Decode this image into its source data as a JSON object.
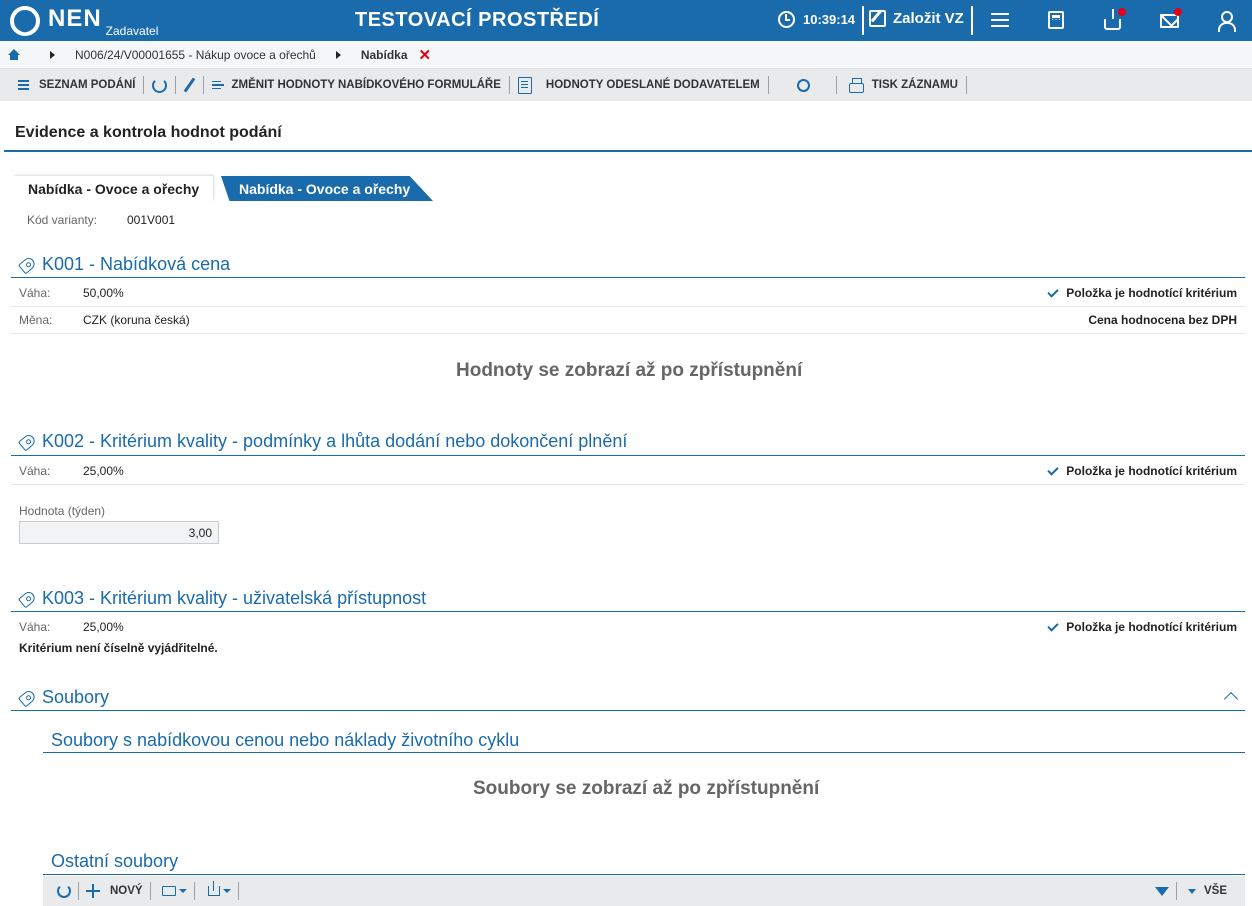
{
  "header": {
    "logo_text": "NEN",
    "logo_sub": "Zadavatel",
    "env_title": "TESTOVACÍ PROSTŘEDÍ",
    "time": "10:39:14",
    "create_label": "Založit VZ"
  },
  "breadcrumb": {
    "item1": "N006/24/V00001655 - Nákup ovoce a ořechů",
    "item2": "Nabídka",
    "close_glyph": "✕"
  },
  "toolbar": {
    "list_label": "SEZNAM PODÁNÍ",
    "change_values_label": "ZMĚNIT HODNOTY NABÍDKOVÉHO FORMULÁŘE",
    "sent_values_label": "HODNOTY ODESLANÉ DODAVATELEM",
    "print_label": "TISK ZÁZNAMU"
  },
  "page": {
    "title": "Evidence a kontrola hodnot podání",
    "tabs": [
      {
        "label": "Nabídka - Ovoce a ořechy",
        "active": false
      },
      {
        "label": "Nabídka - Ovoce a ořechy",
        "active": true
      }
    ],
    "variant_label": "Kód varianty:",
    "variant_value": "001V001"
  },
  "criteria": {
    "k001": {
      "title": "K001 - Nabídková cena",
      "weight_label": "Váha:",
      "weight_value": "50,00%",
      "evaluating_label": "Položka je hodnotící kritérium",
      "currency_label": "Měna:",
      "currency_value": "CZK (koruna česká)",
      "price_note": "Cena hodnocena bez DPH",
      "placeholder": "Hodnoty se zobrazí až po zpřístupnění"
    },
    "k002": {
      "title": "K002 - Kritérium kvality - podmínky a lhůta dodání nebo dokončení plnění",
      "weight_label": "Váha:",
      "weight_value": "25,00%",
      "evaluating_label": "Položka je hodnotící kritérium",
      "value_label": "Hodnota (týden)",
      "value": "3,00"
    },
    "k003": {
      "title": "K003 - Kritérium kvality - uživatelská přístupnost",
      "weight_label": "Váha:",
      "weight_value": "25,00%",
      "evaluating_label": "Položka je hodnotící kritérium",
      "note": "Kritérium není číselně vyjádřitelné."
    }
  },
  "files": {
    "title": "Soubory",
    "price_files_title": "Soubory s nabídkovou cenou nebo náklady životního cyklu",
    "price_files_placeholder": "Soubory se zobrazí až po zpřístupnění",
    "other_files_title": "Ostatní soubory",
    "new_label": "NOVÝ",
    "all_label": "VŠE"
  },
  "colors": {
    "brand": "#1a6bab",
    "alert": "#e3001b"
  }
}
